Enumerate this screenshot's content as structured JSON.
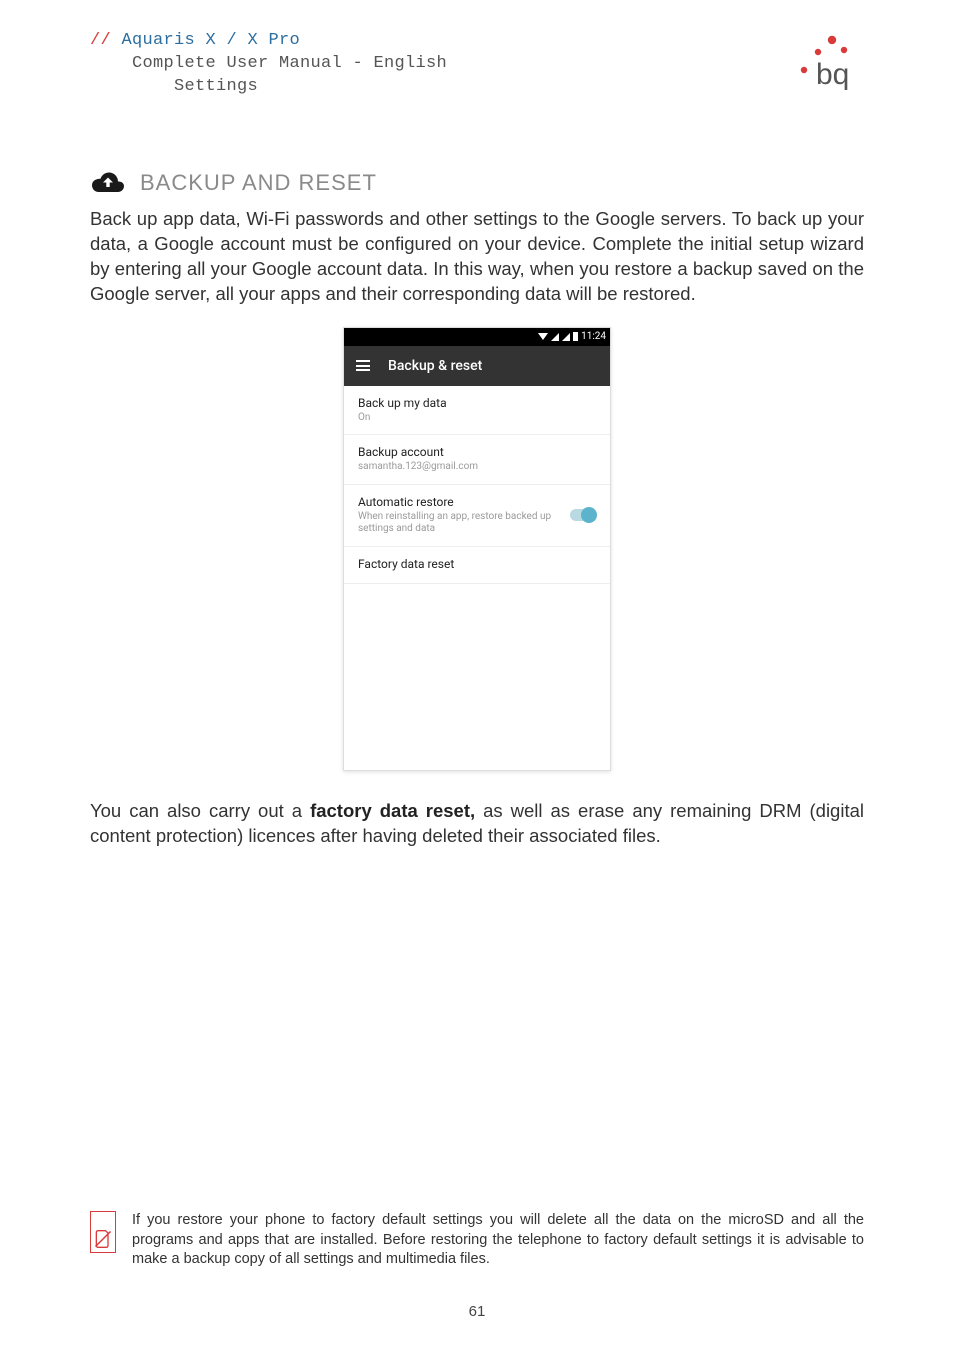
{
  "header": {
    "slashes": "//",
    "product": "Aquaris X / X Pro",
    "line2": "Complete User Manual - English",
    "line3": "Settings"
  },
  "section": {
    "title": "BACKUP AND RESET",
    "intro": "Back up app data, Wi-Fi passwords and other settings to the Google servers. To back up your data, a Google account must be configured on your device. Complete the initial setup wizard by entering all your Google account data. In this way, when you restore a backup saved on the Google server, all your apps and their corresponding data will be restored."
  },
  "phone": {
    "time": "11:24",
    "appbar_title": "Backup & reset",
    "rows": {
      "r1_title": "Back up my data",
      "r1_sub": "On",
      "r2_title": "Backup account",
      "r2_sub": "samantha.123@gmail.com",
      "r3_title": "Automatic restore",
      "r3_sub": "When reinstalling an app, restore backed up settings and data",
      "r4_title": "Factory data reset"
    }
  },
  "para2_pre": "You can also carry out a ",
  "para2_bold": "factory data reset,",
  "para2_post": " as well as erase any remaining DRM (digital content protection) licences after having deleted their associated files.",
  "warning": "If you restore your phone to factory default settings you will delete all the data on the microSD and all the programs and apps that are installed. Before restoring the telephone to factory default settings it is advisable to make a backup copy of all settings and multimedia files.",
  "page_number": "61"
}
